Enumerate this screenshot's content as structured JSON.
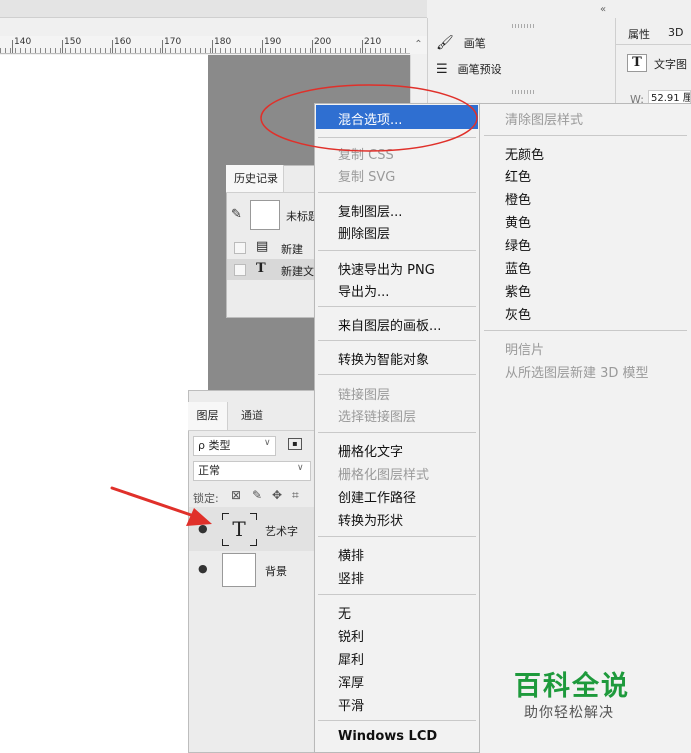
{
  "ruler": {
    "labels": [
      "140",
      "150",
      "160",
      "170",
      "180",
      "190",
      "200",
      "210"
    ]
  },
  "brush_panel": {
    "items": [
      {
        "icon": "brush-icon",
        "label": "画笔"
      },
      {
        "icon": "brush-presets-icon",
        "label": "画笔预设"
      }
    ]
  },
  "props_panel": {
    "tabs": [
      "属性",
      "3D"
    ],
    "text_icon": "T",
    "layer_type": "文字图",
    "w_label": "W:",
    "w_value": "52.91 厘"
  },
  "history_panel": {
    "tab": "历史记录",
    "snapshot_label": "未标题",
    "rows": [
      {
        "icon": "document-icon",
        "glyph": "▤",
        "label": "新建"
      },
      {
        "icon": "type-tool-icon",
        "glyph": "T",
        "label": "新建文"
      }
    ]
  },
  "layers_panel": {
    "tabs": [
      "图层",
      "通道"
    ],
    "filter": "ρ 类型",
    "blend": "正常",
    "lock_label": "锁定:",
    "layers": [
      {
        "name": "艺术字",
        "type": "text",
        "glyph": "T"
      },
      {
        "name": "背景",
        "type": "image",
        "glyph": ""
      }
    ]
  },
  "context_menu": {
    "col1": [
      {
        "label": "混合选项...",
        "disabled": false,
        "highlight": true
      },
      {
        "label": "复制 CSS",
        "disabled": true
      },
      {
        "label": "复制 SVG",
        "disabled": true
      },
      {
        "label": "复制图层...",
        "disabled": false
      },
      {
        "label": "删除图层",
        "disabled": false
      },
      {
        "label": "快速导出为 PNG",
        "disabled": false
      },
      {
        "label": "导出为...",
        "disabled": false
      },
      {
        "label": "来自图层的画板...",
        "disabled": false
      },
      {
        "label": "转换为智能对象",
        "disabled": false
      },
      {
        "label": "链接图层",
        "disabled": true
      },
      {
        "label": "选择链接图层",
        "disabled": true
      },
      {
        "label": "栅格化文字",
        "disabled": false
      },
      {
        "label": "栅格化图层样式",
        "disabled": true
      },
      {
        "label": "创建工作路径",
        "disabled": false
      },
      {
        "label": "转换为形状",
        "disabled": false
      },
      {
        "label": "横排",
        "disabled": false
      },
      {
        "label": "竖排",
        "disabled": false
      },
      {
        "label": "无",
        "disabled": false
      },
      {
        "label": "锐利",
        "disabled": false
      },
      {
        "label": "犀利",
        "disabled": false
      },
      {
        "label": "浑厚",
        "disabled": false
      },
      {
        "label": "平滑",
        "disabled": false
      },
      {
        "label": "Windows LCD",
        "disabled": false
      }
    ],
    "col2": [
      {
        "label": "清除图层样式",
        "disabled": true
      },
      {
        "label": "无颜色",
        "disabled": false
      },
      {
        "label": "红色",
        "disabled": false
      },
      {
        "label": "橙色",
        "disabled": false
      },
      {
        "label": "黄色",
        "disabled": false
      },
      {
        "label": "绿色",
        "disabled": false
      },
      {
        "label": "蓝色",
        "disabled": false
      },
      {
        "label": "紫色",
        "disabled": false
      },
      {
        "label": "灰色",
        "disabled": false
      },
      {
        "label": "明信片",
        "disabled": true
      },
      {
        "label": "从所选图层新建 3D 模型",
        "disabled": true
      }
    ]
  },
  "watermark": {
    "title": "百科全说",
    "subtitle": "助你轻松解决"
  },
  "colors": {
    "highlight": "#2f6fd1",
    "annotation": "#e0302a",
    "watermark": "#1e9a3c"
  }
}
